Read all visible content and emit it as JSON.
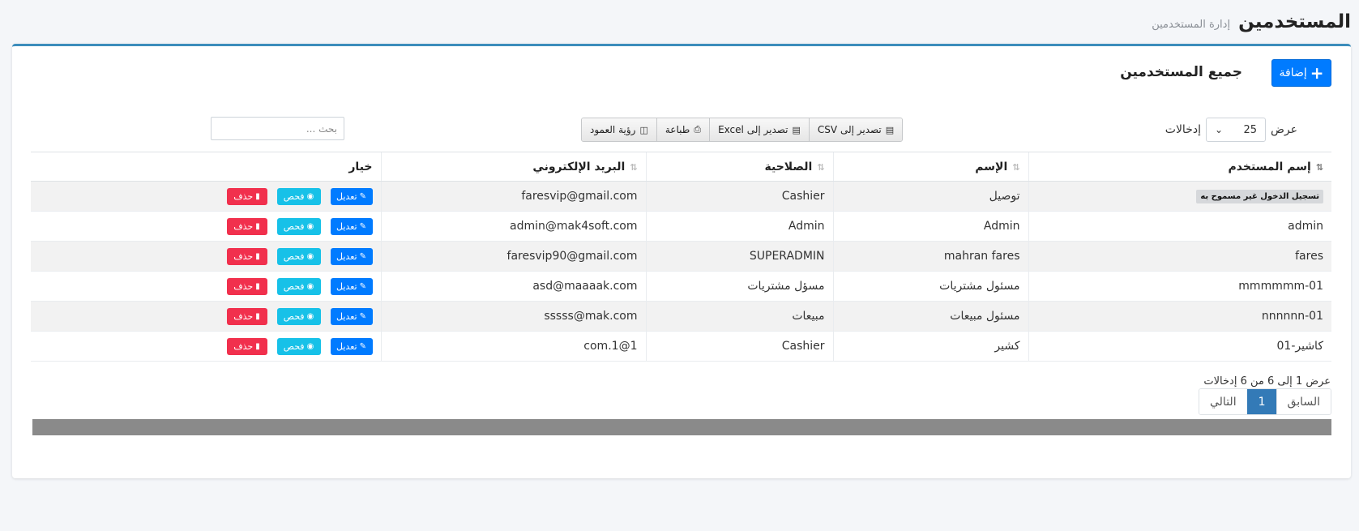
{
  "header": {
    "title": "المستخدمين",
    "subtitle": "إدارة المستخدمين"
  },
  "card": {
    "title": "جميع المستخدمين",
    "add_label": "إضافة"
  },
  "length": {
    "show_label": "عرض",
    "value": "25",
    "entries_label": "إدخالات"
  },
  "toolbar": {
    "csv_label": "تصدير إلى CSV",
    "excel_label": "تصدير إلى Excel",
    "print_label": "طباعة",
    "columns_label": "رؤية العمود"
  },
  "search": {
    "placeholder": "بحث ..."
  },
  "table": {
    "headers": {
      "username": "إسم المستخدم",
      "name": "الإسم",
      "role": "الصلاحية",
      "email": "البريد الإلكتروني",
      "options": "خيار"
    },
    "rows": [
      {
        "username": "",
        "badge": "تسجيل الدخول غير مسموح به",
        "name": "توصيل",
        "role": "Cashier",
        "email": "faresvip@gmail.com"
      },
      {
        "username": "admin",
        "badge": "",
        "name": "Admin",
        "role": "Admin",
        "email": "admin@mak4soft.com"
      },
      {
        "username": "fares",
        "badge": "",
        "name": "mahran fares",
        "role": "SUPERADMIN",
        "email": "faresvip90@gmail.com"
      },
      {
        "username": "mmmmmm-01",
        "badge": "",
        "name": "مسئول مشتريات",
        "role": "مسؤل مشتريات",
        "email": "asd@maaaak.com"
      },
      {
        "username": "nnnnnn-01",
        "badge": "",
        "name": "مسئول مبيعات",
        "role": "مبيعات",
        "email": "sssss@mak.com"
      },
      {
        "username": "كاشير-01",
        "badge": "",
        "name": "كشير",
        "role": "Cashier",
        "email": "1@1.com"
      }
    ],
    "actions": {
      "edit": "تعديل",
      "view": "فحص",
      "delete": "حذف"
    }
  },
  "info": "عرض 1 إلى 6 من 6 إدخالات",
  "pager": {
    "prev": "السابق",
    "current": "1",
    "next": "التالي"
  },
  "colors": {
    "accent": "#3c8dbc",
    "primary": "#007bff",
    "info": "#17c1e8",
    "danger": "#f1304d"
  },
  "icons": {
    "add": "plus-icon",
    "csv": "file-csv-icon",
    "excel": "file-excel-icon",
    "print": "print-icon",
    "columns": "columns-icon",
    "sort": "sort-icon",
    "edit": "edit-icon",
    "view": "eye-icon",
    "delete": "trash-icon"
  }
}
